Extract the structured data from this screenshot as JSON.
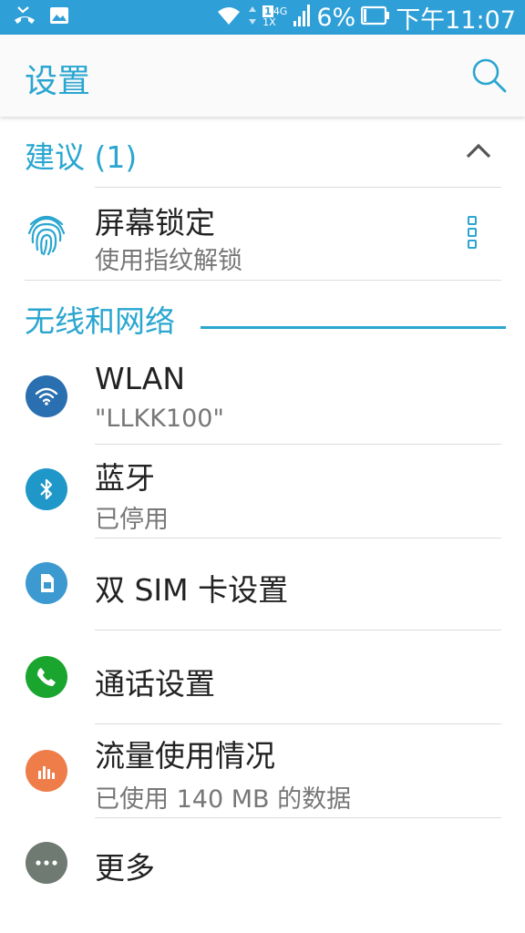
{
  "status_bar": {
    "battery_percent": "6%",
    "time": "下午11:07",
    "net_top": "4G",
    "net_bottom": "1X",
    "sim_badge": "1",
    "icons": [
      "missed-call-icon",
      "image-icon",
      "wifi-icon",
      "data-arrows-icon",
      "signal-icon",
      "battery-icon"
    ]
  },
  "app_bar": {
    "title": "设置",
    "search_icon": "search-icon"
  },
  "suggestions": {
    "header": "建议 (1)",
    "items": [
      {
        "title": "屏幕锁定",
        "subtitle": "使用指纹解锁",
        "icon": "fingerprint-icon"
      }
    ]
  },
  "wireless": {
    "header": "无线和网络",
    "items": [
      {
        "title": "WLAN",
        "subtitle": "\"LLKK100\"",
        "icon": "wifi-icon",
        "color": "#2a6fb0"
      },
      {
        "title": "蓝牙",
        "subtitle": "已停用",
        "icon": "bluetooth-icon",
        "color": "#1f97c9"
      },
      {
        "title": "双 SIM 卡设置",
        "subtitle": "",
        "icon": "sim-card-icon",
        "color": "#3d9ad0"
      },
      {
        "title": "通话设置",
        "subtitle": "",
        "icon": "phone-icon",
        "color": "#1aa52e"
      },
      {
        "title": "流量使用情况",
        "subtitle": "已使用 140 MB 的数据",
        "icon": "data-usage-icon",
        "color": "#ee7d4a"
      },
      {
        "title": "更多",
        "subtitle": "",
        "icon": "more-icon",
        "color": "#6f7a73"
      }
    ]
  },
  "colors": {
    "accent": "#2aa6d0",
    "status_bar": "#2f9fd7"
  }
}
